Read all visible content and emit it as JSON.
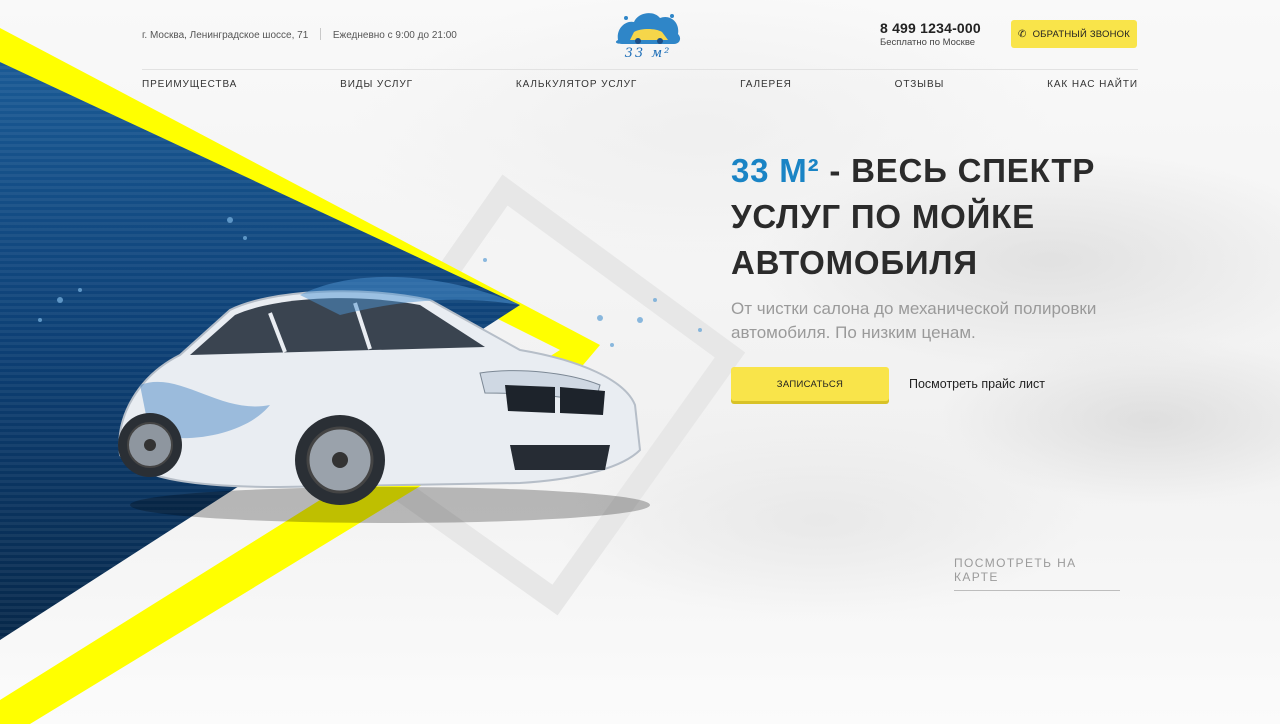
{
  "header": {
    "address": "г. Москва, Ленинградское шоссе, 71",
    "hours": "Ежедневно с 9:00 до 21:00",
    "logo_text": "33 м²",
    "phone": "8 499 1234-000",
    "phone_note": "Бесплатно по Москве",
    "callback_label": "ОБРАТНЫЙ ЗВОНОК"
  },
  "nav": {
    "items": [
      {
        "label": "ПРЕИМУЩЕСТВА"
      },
      {
        "label": "ВИДЫ УСЛУГ"
      },
      {
        "label": "КАЛЬКУЛЯТОР УСЛУГ"
      },
      {
        "label": "ГАЛЕРЕЯ"
      },
      {
        "label": "ОТЗЫВЫ"
      },
      {
        "label": "КАК НАС НАЙТИ"
      }
    ]
  },
  "hero": {
    "title_accent": "33 М²",
    "title_rest_1": " - ВЕСЬ СПЕКТР",
    "title_line_2": "УСЛУГ ПО МОЙКЕ",
    "title_line_3": "АВТОМОБИЛЯ",
    "subtitle_line_1": "От чистки салона до механической полировки",
    "subtitle_line_2": "автомобиля. По низким ценам.",
    "cta_label": "ЗАПИСАТЬСЯ",
    "price_link": "Посмотреть прайс лист"
  },
  "map_link": "ПОСМОТРЕТЬ НА КАРТЕ",
  "colors": {
    "accent_blue": "#1a84c5",
    "accent_yellow": "#f9e44a",
    "navy": "#0b3f73",
    "stripe_yellow": "#ffff00"
  },
  "icons": {
    "phone": "phone-icon"
  }
}
